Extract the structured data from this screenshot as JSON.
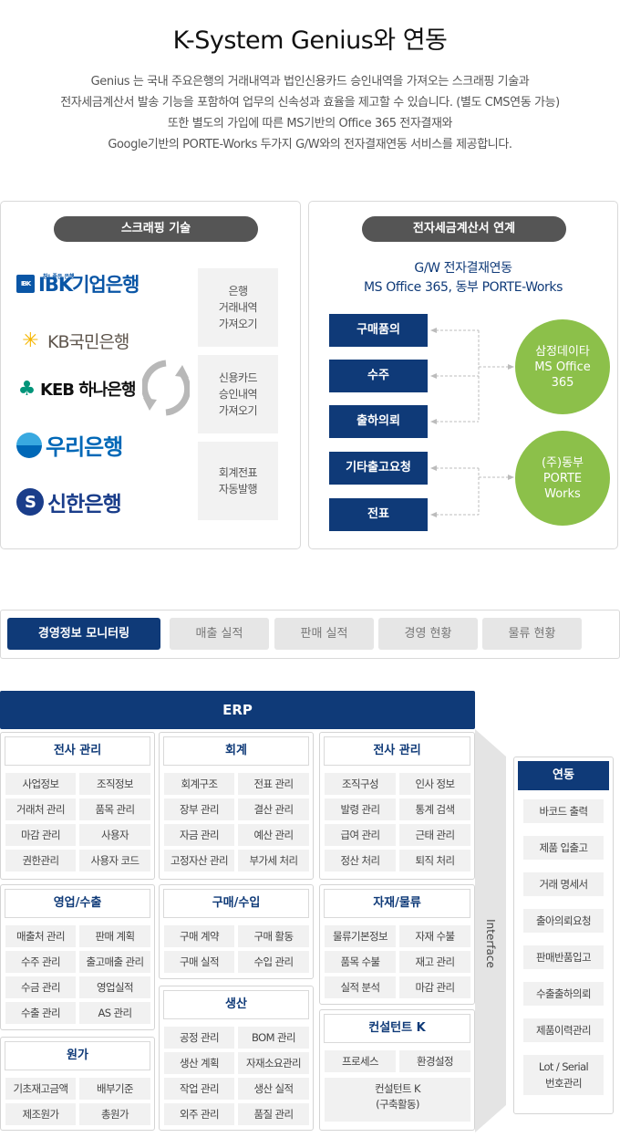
{
  "header": {
    "title": "K-System Genius와 연동",
    "intro_lines": [
      "Genius 는 국내 주요은행의 거래내역과 법인신용카드 승인내역을 가져오는 스크래핑 기술과",
      "전자세금계산서 발송 기능을 포함하여 업무의 신속성과 효율을 제고할 수  있습니다. (별도 CMS연동 가능)",
      "또한 별도의 가입에 따른 MS기반의 Office 365 전자결재와",
      "Google기반의 PORTE-Works 두가지 G/W와의 전자결재연동 서비스를 제공합니다."
    ]
  },
  "scraping": {
    "title": "스크래핑 기술",
    "banks": {
      "ibk_tag": "참! 좋은 은행",
      "ibk_mark": "IBK",
      "ibk": "IBK기업은행",
      "kb": "KB국민은행",
      "keb": "KEB 하나은행",
      "woori": "우리은행",
      "shinhan": "신한은행"
    },
    "features": [
      [
        "은행",
        "거래내역",
        "가져오기"
      ],
      [
        "신용카드",
        "승인내역",
        "가져오기"
      ],
      [
        "회계전표",
        "자동발행"
      ]
    ]
  },
  "einvoice": {
    "title": "전자세금계산서 연계",
    "gw_line1": "G/W 전자결재연동",
    "gw_line2": "MS Office 365, 동부 PORTE-Works",
    "docs": [
      "구매품의",
      "수주",
      "출하의뢰",
      "기타출고요청",
      "전표"
    ],
    "partners": [
      [
        "삼정데이타",
        "MS Office",
        "365"
      ],
      [
        "(주)동부",
        "PORTE",
        "Works"
      ]
    ]
  },
  "tabs": [
    "경영정보 모니터링",
    "매출 실적",
    "판매 실적",
    "경영 현황",
    "물류 현황"
  ],
  "erp": {
    "title": "ERP",
    "interface_label": "Interface",
    "modules": {
      "hr1": {
        "title": "전사 관리",
        "items": [
          "사업정보",
          "조직정보",
          "거래처 관리",
          "품목 관리",
          "마감 관리",
          "사용자",
          "권한관리",
          "사용자 코드"
        ]
      },
      "acct": {
        "title": "회계",
        "items": [
          "회계구조",
          "전표 관리",
          "장부 관리",
          "결산 관리",
          "자금 관리",
          "예산 관리",
          "고정자산 관리",
          "부가세 처리"
        ]
      },
      "hr2": {
        "title": "전사 관리",
        "items": [
          "조직구성",
          "인사 정보",
          "발령 관리",
          "통계 검색",
          "급여 관리",
          "근태 관리",
          "정산 처리",
          "퇴직 처리"
        ]
      },
      "sales": {
        "title": "영업/수출",
        "items": [
          "매출처 관리",
          "판매 계획",
          "수주 관리",
          "출고매출 관리",
          "수금 관리",
          "영업실적",
          "수출 관리",
          "AS 관리"
        ]
      },
      "purchase": {
        "title": "구매/수입",
        "items": [
          "구매 계약",
          "구매 활동",
          "구매 실적",
          "수입 관리"
        ]
      },
      "material": {
        "title": "자재/물류",
        "items": [
          "물류기본정보",
          "자재 수불",
          "품목 수불",
          "재고 관리",
          "실적 분석",
          "마감 관리"
        ]
      },
      "cost": {
        "title": "원가",
        "items": [
          "기초재고금액",
          "배부기준",
          "제조원가",
          "총원가"
        ]
      },
      "production": {
        "title": "생산",
        "items": [
          "공정 관리",
          "BOM 관리",
          "생산 계획",
          "자재소요관리",
          "작업 관리",
          "생산 실적",
          "외주 관리",
          "품질 관리"
        ]
      },
      "consultant": {
        "title": "컨설턴트 K",
        "items": [
          "프로세스",
          "환경설정"
        ],
        "wide": [
          "컨설턴트 K",
          "(구축활동)"
        ]
      }
    }
  },
  "link": {
    "title": "연동",
    "items": [
      "바코드 출력",
      "제품 입출고",
      "거래 명세서",
      "출아의뢰요청",
      "판매반품입고",
      "수출출하의뢰",
      "제품이력관리"
    ],
    "last": [
      "Lot / Serial",
      "번호관리"
    ]
  },
  "colors": {
    "navy": "#0f3a78",
    "green": "#8cc04a",
    "pill": "#555555"
  }
}
